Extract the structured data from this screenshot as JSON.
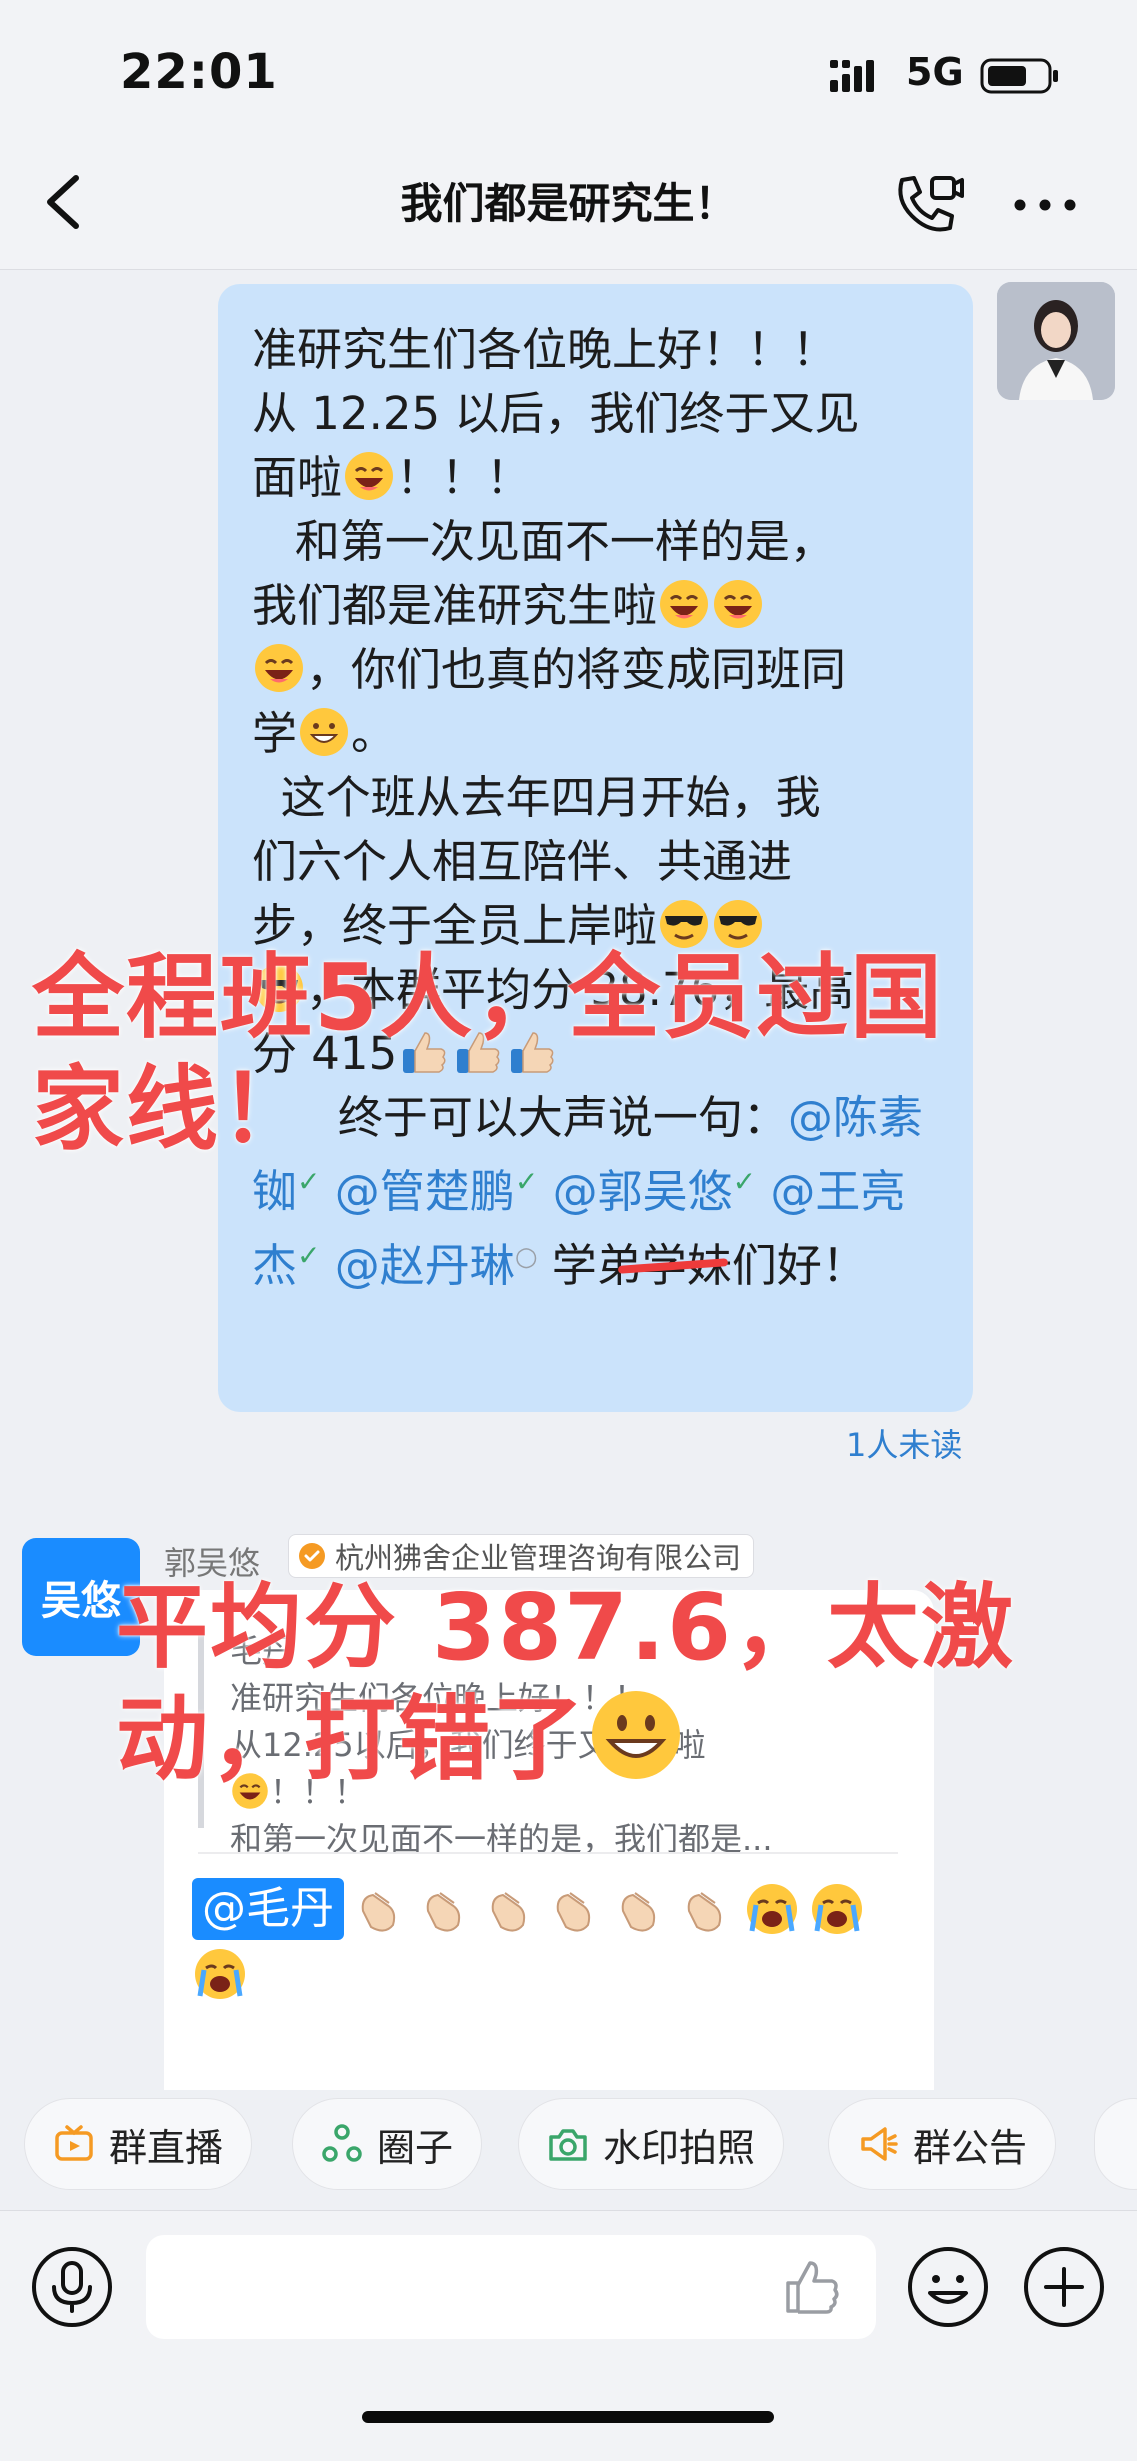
{
  "status_bar": {
    "time": "22:01",
    "network": "5G"
  },
  "header": {
    "title": "我们都是研究生！"
  },
  "messages": {
    "mine": {
      "lines": [
        "准研究生们各位晚上好！！！",
        "从 12.25 以后，我们终于又见",
        "面啦",
        "！！！",
        "   和第一次见面不一样的是，",
        "我们都是准研究生啦",
        "，你们也真的将变成同班同",
        "学",
        "。",
        "  这个班从去年四月开始，我",
        "们六个人相互陪伴、共通进",
        "步，终于全员上岸啦",
        "，本群平均分 38.76，最高",
        "分 415",
        "      终于可以大声说一句：",
        "@陈素铷",
        "@管楚鹏",
        "@郭吴悠",
        "@王亮杰",
        "@赵丹琳",
        " 学弟学",
        "妹们好！"
      ],
      "unread": "1人未读"
    },
    "reply": {
      "avatar_text": "吴悠",
      "sender": "郭吴悠",
      "company": "杭州狒舍企业管理咨询有限公司",
      "quote_author": "毛丹",
      "quote_lines": [
        "准研究生们各位晚上好！！！",
        "从12.25以后，我们终于又见面啦",
        "！！！",
        "   和第一次见面不一样的是，我们都是..."
      ],
      "mention": "@毛丹"
    }
  },
  "overlay": {
    "top_line1": "全程班5人，全员过国",
    "top_line2": "家线！",
    "bottom_line1": "平均分 387.6，太激",
    "bottom_line2": "动，打错了"
  },
  "quick_actions": [
    {
      "label": "群直播",
      "icon": "live-tv-icon",
      "color": "#f59a23"
    },
    {
      "label": "圈子",
      "icon": "circle-group-icon",
      "color": "#3aa66a"
    },
    {
      "label": "水印拍照",
      "icon": "camera-icon",
      "color": "#3aa66a"
    },
    {
      "label": "群公告",
      "icon": "megaphone-icon",
      "color": "#f59a23"
    }
  ],
  "input": {
    "placeholder": ""
  },
  "colors": {
    "accent": "#1a8cff",
    "bubble_mine": "#cbe3fb",
    "overlay_red": "#f04a4a"
  }
}
